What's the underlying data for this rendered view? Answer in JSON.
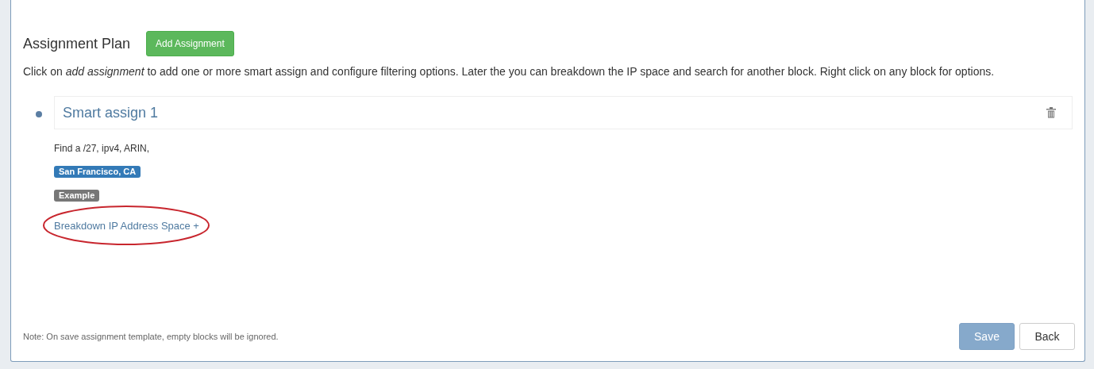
{
  "header": {
    "title": "Assignment Plan",
    "add_button": "Add Assignment"
  },
  "description": "Click on *add assignment* to add one or more smart assign and configure filtering options. Later the you can breakdown the IP space and search for another block. Right click on any block for options.",
  "blocks": [
    {
      "title": "Smart assign 1",
      "summary": "Find a /27, ipv4, ARIN,",
      "tags": [
        {
          "label": "San Francisco, CA",
          "color": "#337ab7"
        },
        {
          "label": "Example",
          "color": "#777777"
        }
      ],
      "link": "Breakdown IP Address Space +",
      "circled": true
    }
  ],
  "note": "Note: On save assignment template, empty blocks will be ignored.",
  "buttons": [
    {
      "label": "Save",
      "kind": "primary",
      "disabled": true
    },
    {
      "label": "Back",
      "kind": "default",
      "disabled": false
    }
  ]
}
